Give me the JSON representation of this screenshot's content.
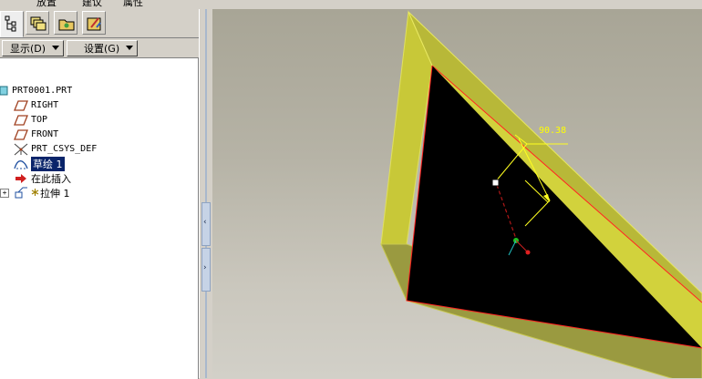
{
  "menu": {
    "items": [
      "放置",
      "建议",
      "属性"
    ]
  },
  "navigator": {
    "tabs": [
      {
        "name": "model-tree-tab",
        "icon": "model-tree-icon",
        "active": true
      },
      {
        "name": "layers-tab",
        "icon": "layers-icon",
        "active": false
      },
      {
        "name": "folder-browser-tab",
        "icon": "folder-icon",
        "active": false
      },
      {
        "name": "favorites-tab",
        "icon": "favorites-icon",
        "active": false
      }
    ],
    "show_label": "显示(D)",
    "settings_label": "设置(G)"
  },
  "tree": {
    "root": "PRT0001.PRT",
    "items": [
      {
        "label": "RIGHT",
        "icon": "datum-plane-icon"
      },
      {
        "label": "TOP",
        "icon": "datum-plane-icon"
      },
      {
        "label": "FRONT",
        "icon": "datum-plane-icon"
      },
      {
        "label": "PRT_CSYS_DEF",
        "icon": "csys-icon"
      },
      {
        "label": "草绘 1",
        "icon": "sketch-icon",
        "selected": true
      },
      {
        "label": "在此插入",
        "icon": "insert-here-arrow-icon"
      },
      {
        "label": "拉伸 1",
        "icon": "extrude-icon",
        "collapsed": true
      }
    ]
  },
  "splitter": {
    "collapse_glyph": "‹",
    "expand_glyph": "›"
  },
  "viewport": {
    "dimension_value": "90.38",
    "colors": {
      "solid_face": "#d2d23c",
      "edge_highlight": "#ff2020",
      "dimension": "#ffff00"
    }
  }
}
